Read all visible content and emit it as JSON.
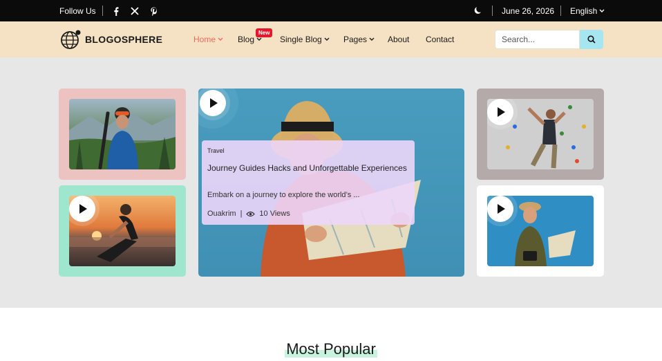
{
  "topbar": {
    "follow_label": "Follow Us",
    "social_icons": [
      "facebook-icon",
      "x-icon",
      "pinterest-icon"
    ],
    "date": "June 26, 2026",
    "language": "English"
  },
  "header": {
    "logo_text": "BLOGOSPHERE",
    "nav": [
      {
        "label": "Home",
        "active": true,
        "dropdown": true
      },
      {
        "label": "Blog",
        "dropdown": true,
        "badge": "New"
      },
      {
        "label": "Single Blog",
        "dropdown": true
      },
      {
        "label": "Pages",
        "dropdown": true
      },
      {
        "label": "About",
        "dropdown": false
      },
      {
        "label": "Contact",
        "dropdown": false
      }
    ],
    "search_placeholder": "Search...",
    "accent": "#ef6a5a"
  },
  "hero": {
    "feature": {
      "category": "Travel",
      "title": "Journey Guides Hacks and Unforgettable Experiences",
      "excerpt": "Embark on a journey to explore the world’s ...",
      "author": "Ouakrim",
      "views": "10 Views"
    },
    "card_colors": [
      "#ecc3c1",
      "#9fe6cf",
      "#b4aaa9",
      "#ffffff"
    ]
  },
  "sections": {
    "most_popular": "Most Popular"
  }
}
